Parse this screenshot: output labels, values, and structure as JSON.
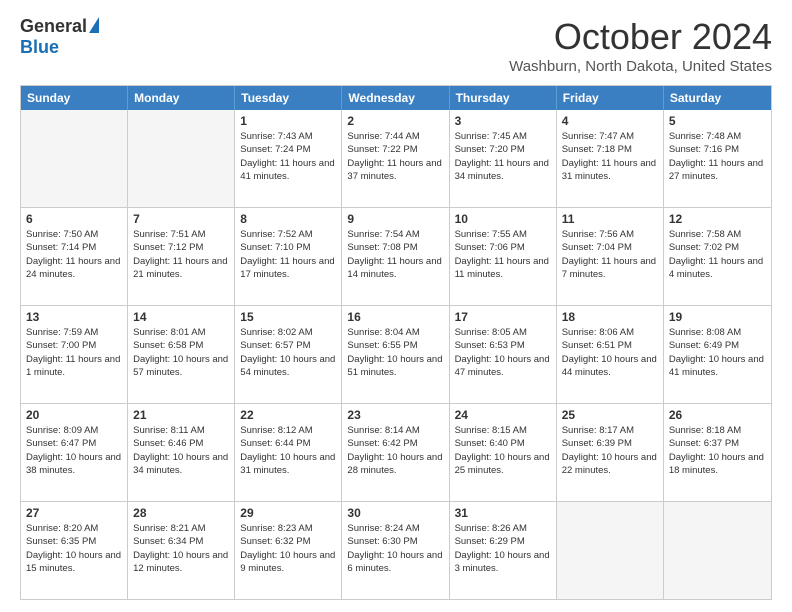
{
  "header": {
    "logo_general": "General",
    "logo_blue": "Blue",
    "title": "October 2024",
    "subtitle": "Washburn, North Dakota, United States"
  },
  "calendar": {
    "days_of_week": [
      "Sunday",
      "Monday",
      "Tuesday",
      "Wednesday",
      "Thursday",
      "Friday",
      "Saturday"
    ],
    "rows": [
      [
        {
          "day": "",
          "info": "",
          "empty": true
        },
        {
          "day": "",
          "info": "",
          "empty": true
        },
        {
          "day": "1",
          "info": "Sunrise: 7:43 AM\nSunset: 7:24 PM\nDaylight: 11 hours and 41 minutes."
        },
        {
          "day": "2",
          "info": "Sunrise: 7:44 AM\nSunset: 7:22 PM\nDaylight: 11 hours and 37 minutes."
        },
        {
          "day": "3",
          "info": "Sunrise: 7:45 AM\nSunset: 7:20 PM\nDaylight: 11 hours and 34 minutes."
        },
        {
          "day": "4",
          "info": "Sunrise: 7:47 AM\nSunset: 7:18 PM\nDaylight: 11 hours and 31 minutes."
        },
        {
          "day": "5",
          "info": "Sunrise: 7:48 AM\nSunset: 7:16 PM\nDaylight: 11 hours and 27 minutes."
        }
      ],
      [
        {
          "day": "6",
          "info": "Sunrise: 7:50 AM\nSunset: 7:14 PM\nDaylight: 11 hours and 24 minutes."
        },
        {
          "day": "7",
          "info": "Sunrise: 7:51 AM\nSunset: 7:12 PM\nDaylight: 11 hours and 21 minutes."
        },
        {
          "day": "8",
          "info": "Sunrise: 7:52 AM\nSunset: 7:10 PM\nDaylight: 11 hours and 17 minutes."
        },
        {
          "day": "9",
          "info": "Sunrise: 7:54 AM\nSunset: 7:08 PM\nDaylight: 11 hours and 14 minutes."
        },
        {
          "day": "10",
          "info": "Sunrise: 7:55 AM\nSunset: 7:06 PM\nDaylight: 11 hours and 11 minutes."
        },
        {
          "day": "11",
          "info": "Sunrise: 7:56 AM\nSunset: 7:04 PM\nDaylight: 11 hours and 7 minutes."
        },
        {
          "day": "12",
          "info": "Sunrise: 7:58 AM\nSunset: 7:02 PM\nDaylight: 11 hours and 4 minutes."
        }
      ],
      [
        {
          "day": "13",
          "info": "Sunrise: 7:59 AM\nSunset: 7:00 PM\nDaylight: 11 hours and 1 minute."
        },
        {
          "day": "14",
          "info": "Sunrise: 8:01 AM\nSunset: 6:58 PM\nDaylight: 10 hours and 57 minutes."
        },
        {
          "day": "15",
          "info": "Sunrise: 8:02 AM\nSunset: 6:57 PM\nDaylight: 10 hours and 54 minutes."
        },
        {
          "day": "16",
          "info": "Sunrise: 8:04 AM\nSunset: 6:55 PM\nDaylight: 10 hours and 51 minutes."
        },
        {
          "day": "17",
          "info": "Sunrise: 8:05 AM\nSunset: 6:53 PM\nDaylight: 10 hours and 47 minutes."
        },
        {
          "day": "18",
          "info": "Sunrise: 8:06 AM\nSunset: 6:51 PM\nDaylight: 10 hours and 44 minutes."
        },
        {
          "day": "19",
          "info": "Sunrise: 8:08 AM\nSunset: 6:49 PM\nDaylight: 10 hours and 41 minutes."
        }
      ],
      [
        {
          "day": "20",
          "info": "Sunrise: 8:09 AM\nSunset: 6:47 PM\nDaylight: 10 hours and 38 minutes."
        },
        {
          "day": "21",
          "info": "Sunrise: 8:11 AM\nSunset: 6:46 PM\nDaylight: 10 hours and 34 minutes."
        },
        {
          "day": "22",
          "info": "Sunrise: 8:12 AM\nSunset: 6:44 PM\nDaylight: 10 hours and 31 minutes."
        },
        {
          "day": "23",
          "info": "Sunrise: 8:14 AM\nSunset: 6:42 PM\nDaylight: 10 hours and 28 minutes."
        },
        {
          "day": "24",
          "info": "Sunrise: 8:15 AM\nSunset: 6:40 PM\nDaylight: 10 hours and 25 minutes."
        },
        {
          "day": "25",
          "info": "Sunrise: 8:17 AM\nSunset: 6:39 PM\nDaylight: 10 hours and 22 minutes."
        },
        {
          "day": "26",
          "info": "Sunrise: 8:18 AM\nSunset: 6:37 PM\nDaylight: 10 hours and 18 minutes."
        }
      ],
      [
        {
          "day": "27",
          "info": "Sunrise: 8:20 AM\nSunset: 6:35 PM\nDaylight: 10 hours and 15 minutes."
        },
        {
          "day": "28",
          "info": "Sunrise: 8:21 AM\nSunset: 6:34 PM\nDaylight: 10 hours and 12 minutes."
        },
        {
          "day": "29",
          "info": "Sunrise: 8:23 AM\nSunset: 6:32 PM\nDaylight: 10 hours and 9 minutes."
        },
        {
          "day": "30",
          "info": "Sunrise: 8:24 AM\nSunset: 6:30 PM\nDaylight: 10 hours and 6 minutes."
        },
        {
          "day": "31",
          "info": "Sunrise: 8:26 AM\nSunset: 6:29 PM\nDaylight: 10 hours and 3 minutes."
        },
        {
          "day": "",
          "info": "",
          "empty": true
        },
        {
          "day": "",
          "info": "",
          "empty": true
        }
      ]
    ]
  }
}
